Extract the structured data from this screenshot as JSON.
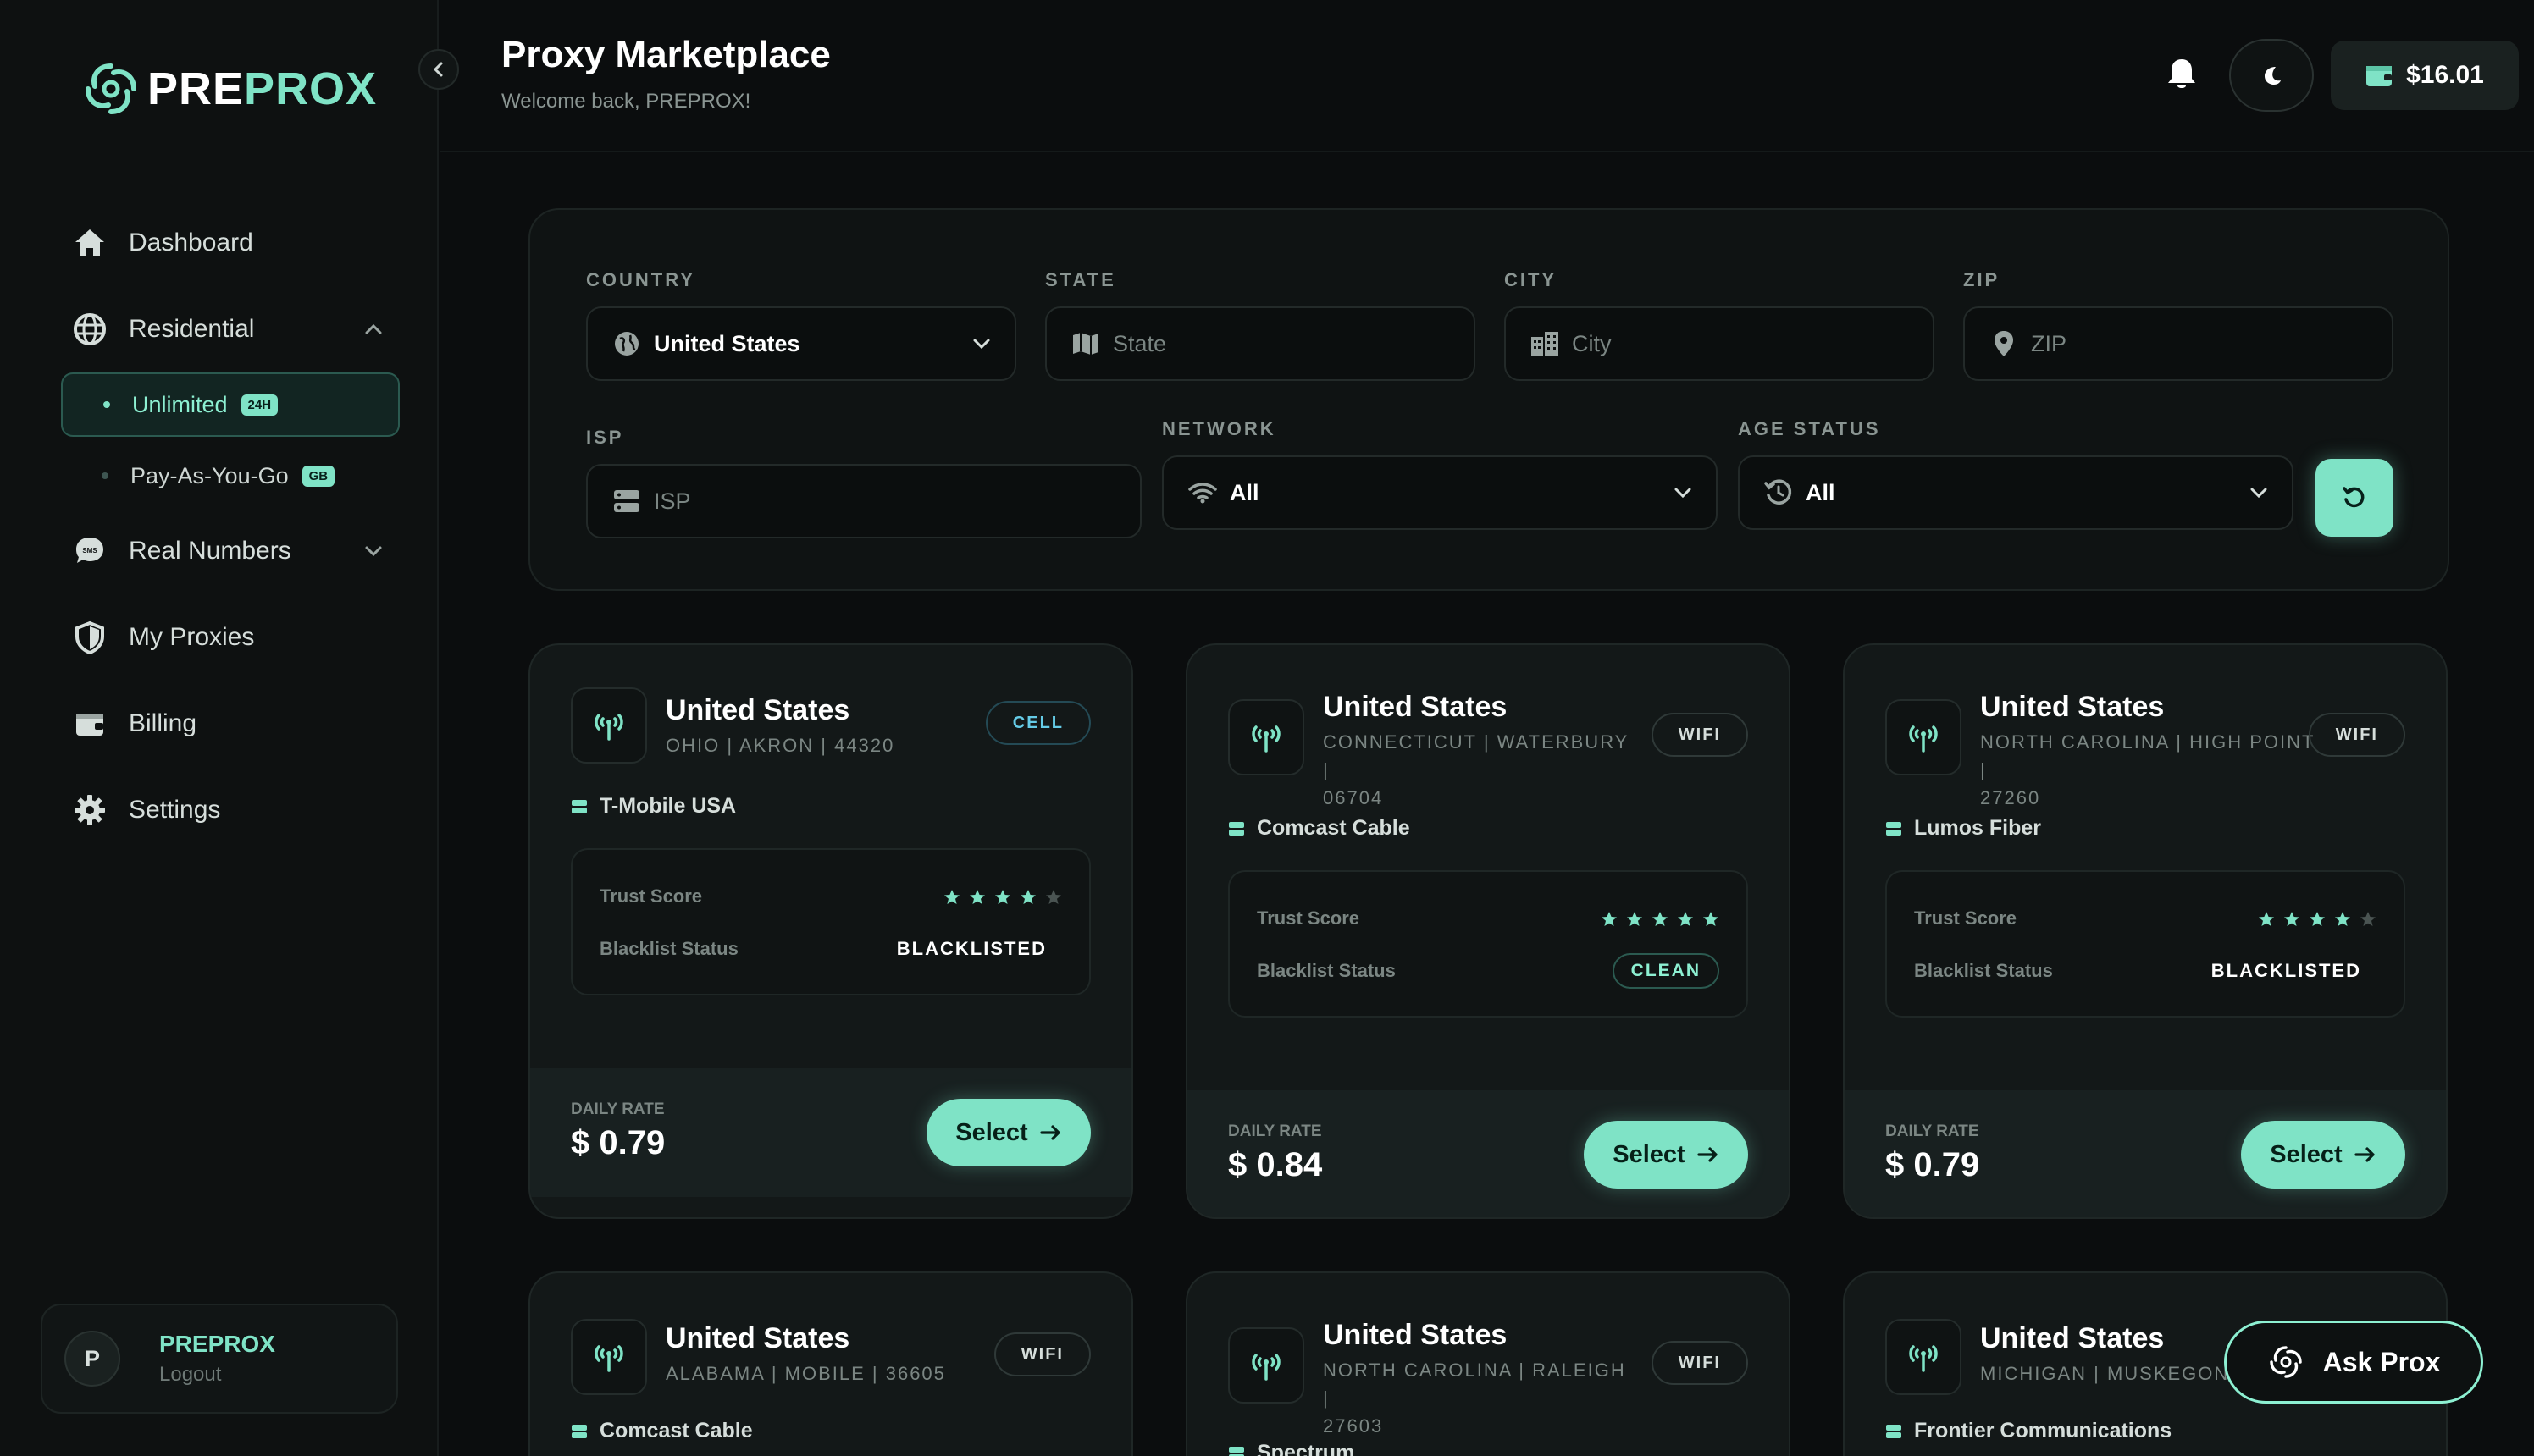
{
  "brand": {
    "name_white": "PRE",
    "name_green": "PROX",
    "accent": "#7fe3c6"
  },
  "sidebar": {
    "items": [
      {
        "label": "Dashboard",
        "icon": "home-icon"
      },
      {
        "label": "Residential",
        "icon": "globe-icon",
        "expanded": true
      },
      {
        "label": "Real Numbers",
        "icon": "sms-icon"
      },
      {
        "label": "My Proxies",
        "icon": "shield-icon"
      },
      {
        "label": "Billing",
        "icon": "wallet-icon"
      },
      {
        "label": "Settings",
        "icon": "gear-icon"
      }
    ],
    "residential_sub": [
      {
        "label": "Unlimited",
        "tag": "24H",
        "active": true
      },
      {
        "label": "Pay-As-You-Go",
        "tag": "GB",
        "active": false
      }
    ],
    "user": {
      "initial": "P",
      "name": "PREPROX",
      "action": "Logout"
    }
  },
  "header": {
    "title": "Proxy Marketplace",
    "subtitle": "Welcome back, PREPROX!",
    "balance": "$16.01"
  },
  "filters": {
    "country": {
      "label": "COUNTRY",
      "value": "United States"
    },
    "state": {
      "label": "STATE",
      "placeholder": "State"
    },
    "city": {
      "label": "CITY",
      "placeholder": "City"
    },
    "zip": {
      "label": "ZIP",
      "placeholder": "ZIP"
    },
    "isp": {
      "label": "ISP",
      "placeholder": "ISP"
    },
    "network": {
      "label": "NETWORK",
      "value": "All"
    },
    "age_status": {
      "label": "AGE STATUS",
      "value": "All"
    }
  },
  "card_labels": {
    "trust_score": "Trust Score",
    "blacklist_status": "Blacklist Status",
    "daily_rate": "DAILY RATE",
    "select": "Select"
  },
  "cards": [
    {
      "country": "United States",
      "location": "OHIO | AKRON | 44320",
      "network": "CELL",
      "isp": "T-Mobile USA",
      "trust_score": 4,
      "blacklist": "BLACKLISTED",
      "rate": "$ 0.79"
    },
    {
      "country": "United States",
      "location_l1": "CONNECTICUT | WATERBURY |",
      "location_l2": "06704",
      "network": "WIFI",
      "isp": "Comcast Cable",
      "trust_score": 5,
      "blacklist": "CLEAN",
      "rate": "$ 0.84"
    },
    {
      "country": "United States",
      "location_l1": "NORTH CAROLINA | HIGH POINT |",
      "location_l2": "27260",
      "network": "WIFI",
      "isp": "Lumos Fiber",
      "trust_score": 4,
      "blacklist": "BLACKLISTED",
      "rate": "$ 0.79"
    },
    {
      "country": "United States",
      "location": "ALABAMA | MOBILE | 36605",
      "network": "WIFI",
      "isp": "Comcast Cable"
    },
    {
      "country": "United States",
      "location_l1": "NORTH CAROLINA | RALEIGH |",
      "location_l2": "27603",
      "network": "WIFI",
      "isp": "Spectrum"
    },
    {
      "country": "United States",
      "location": "MICHIGAN | MUSKEGON",
      "isp": "Frontier Communications"
    }
  ],
  "assistant": {
    "label": "Ask Prox"
  }
}
